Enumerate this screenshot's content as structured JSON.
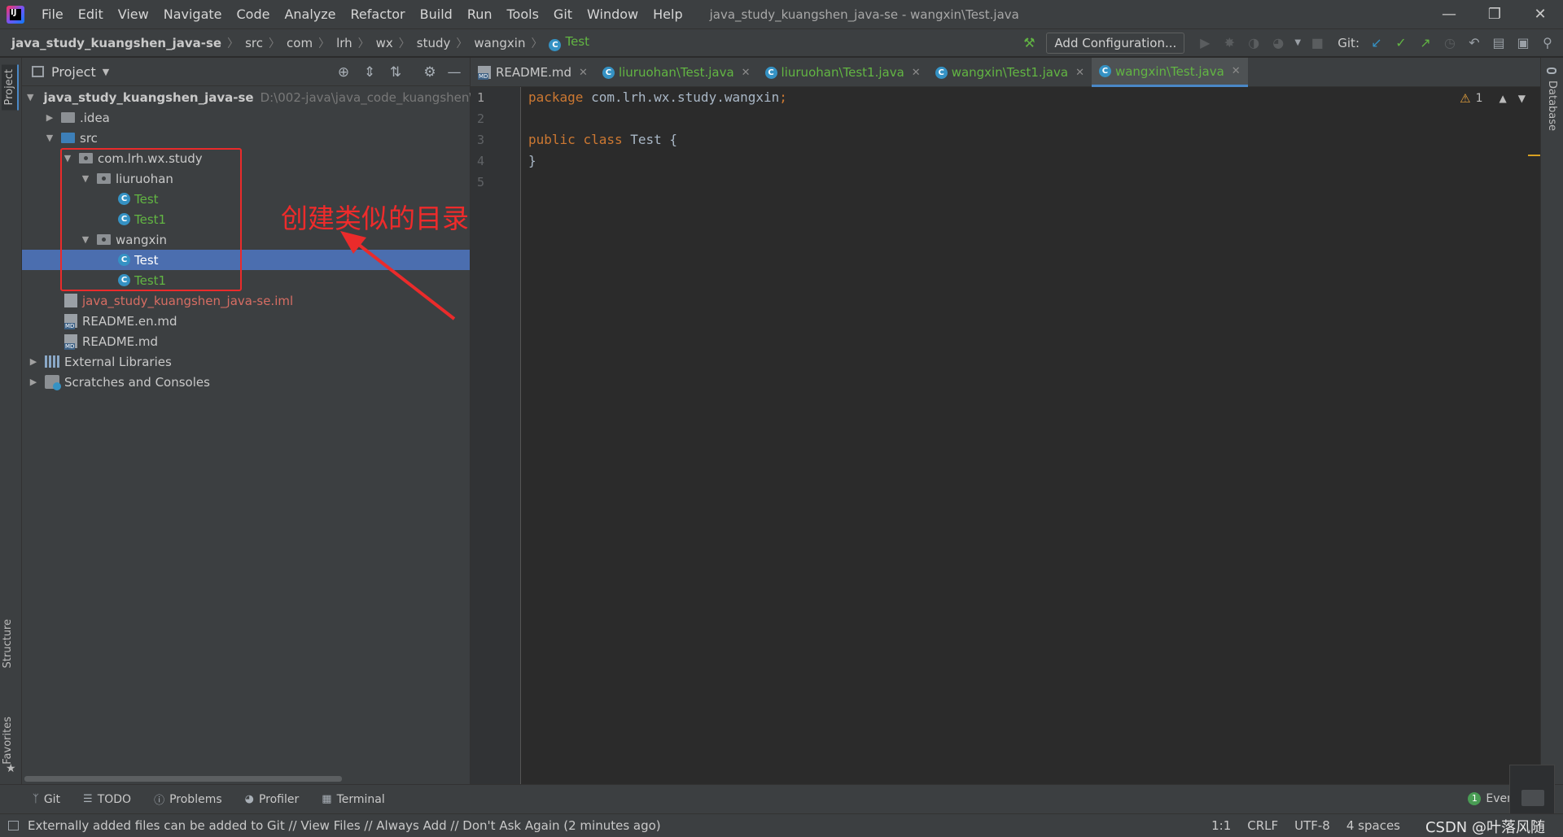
{
  "menu": {
    "items": [
      "File",
      "Edit",
      "View",
      "Navigate",
      "Code",
      "Analyze",
      "Refactor",
      "Build",
      "Run",
      "Tools",
      "Git",
      "Window",
      "Help"
    ],
    "window_title": "java_study_kuangshen_java-se - wangxin\\Test.java",
    "logo_text": "IJ"
  },
  "breadcrumb": {
    "project": "java_study_kuangshen_java-se",
    "parts": [
      "src",
      "com",
      "lrh",
      "wx",
      "study",
      "wangxin"
    ],
    "file": "Test"
  },
  "toolbar": {
    "add_configuration": "Add Configuration...",
    "git_label": "Git:"
  },
  "left_strip": {
    "project": "Project",
    "structure": "Structure",
    "favorites": "Favorites"
  },
  "right_strip": {
    "database": "Database"
  },
  "project_panel": {
    "title": "Project",
    "tree": [
      {
        "label": "java_study_kuangshen_java-se",
        "path": "D:\\002-java\\java_code_kuangshen\\ja"
      },
      {
        "label": ".idea"
      },
      {
        "label": "src"
      },
      {
        "label": "com.lrh.wx.study"
      },
      {
        "label": "liuruohan"
      },
      {
        "label": "Test"
      },
      {
        "label": "Test1"
      },
      {
        "label": "wangxin"
      },
      {
        "label": "Test"
      },
      {
        "label": "Test1"
      },
      {
        "label": "java_study_kuangshen_java-se.iml"
      },
      {
        "label": "README.en.md"
      },
      {
        "label": "README.md"
      },
      {
        "label": "External Libraries"
      },
      {
        "label": "Scratches and Consoles"
      }
    ]
  },
  "annotation": {
    "text": "创建类似的目录"
  },
  "editor": {
    "tabs": [
      {
        "label": "README.md"
      },
      {
        "label": "liuruohan\\Test.java"
      },
      {
        "label": "liuruohan\\Test1.java"
      },
      {
        "label": "wangxin\\Test1.java"
      },
      {
        "label": "wangxin\\Test.java"
      }
    ],
    "line_numbers": [
      "1",
      "2",
      "3",
      "4",
      "5"
    ],
    "code": {
      "l1_kw": "package",
      "l1_rest": " com.lrh.wx.study.wangxin",
      "l1_semi": ";",
      "l3_kw1": "public",
      "l3_kw2": "class",
      "l3_name": "Test",
      "l3_brace": "{",
      "l4": "}"
    },
    "warning_count": "1"
  },
  "bottom_tools": [
    "Git",
    "TODO",
    "Problems",
    "Profiler",
    "Terminal"
  ],
  "event_log": {
    "count": "1",
    "label": "Even"
  },
  "status": {
    "message": "Externally added files can be added to Git // View Files // Always Add // Don't Ask Again (2 minutes ago)",
    "position": "1:1",
    "line_sep": "CRLF",
    "encoding": "UTF-8",
    "indent": "4 spaces",
    "watermark": "CSDN @叶落风随"
  },
  "colors": {
    "accent": "#4a88c7",
    "selection": "#4b6eaf",
    "vcs_added": "#62b543",
    "vcs_unversioned": "#d66d63",
    "annotation": "#ea2b2b"
  }
}
